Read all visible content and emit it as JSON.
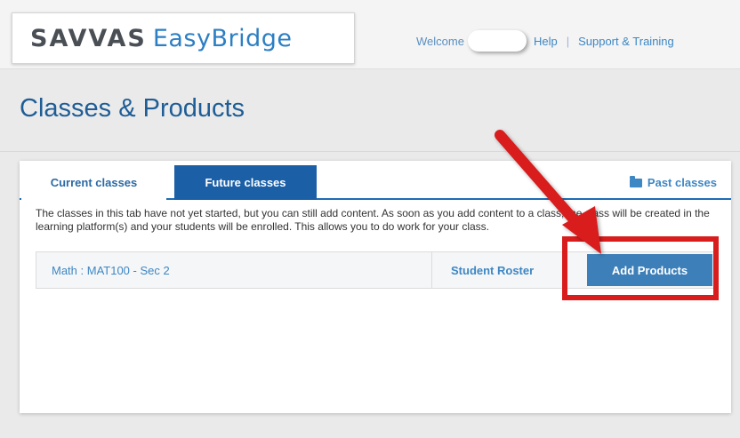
{
  "header": {
    "logo_brand": "SAVVAS",
    "logo_product": "EasyBridge",
    "welcome": "Welcome",
    "help": "Help",
    "separator": "|",
    "support": "Support & Training"
  },
  "page": {
    "title": "Classes & Products"
  },
  "tabs": [
    {
      "label": "Current classes",
      "active": false
    },
    {
      "label": "Future classes",
      "active": true
    }
  ],
  "past_classes": "Past classes",
  "info_text": "The classes in this tab have not yet started, but you can still add content. As soon as you add content to a class, the class will be created in the learning platform(s) and your students will be enrolled. This allows you to do work for your class.",
  "class_row": {
    "name": "Math : MAT100 - Sec 2",
    "student_roster": "Student Roster",
    "add_products": "Add Products"
  },
  "colors": {
    "brand_blue": "#1b5fa6",
    "link_blue": "#3d87c4",
    "highlight_red": "#d91c1c"
  },
  "icons": [
    "folder-icon",
    "arrow-annotation"
  ]
}
